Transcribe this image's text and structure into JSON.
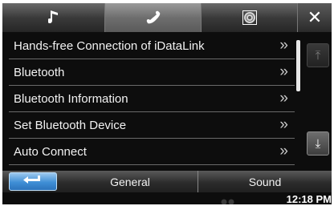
{
  "tabs": [
    {
      "name": "music",
      "icon": "music-note-icon",
      "active": false
    },
    {
      "name": "phone",
      "icon": "phone-icon",
      "active": true
    },
    {
      "name": "media",
      "icon": "disc-icon",
      "active": false
    }
  ],
  "close_icon": "close-icon",
  "close_glyph": "✕",
  "menu": {
    "items": [
      {
        "label": "Hands-free Connection of iDataLink",
        "chevron": "»"
      },
      {
        "label": "Bluetooth",
        "chevron": "»"
      },
      {
        "label": "Bluetooth Information",
        "chevron": "»"
      },
      {
        "label": "Set Bluetooth Device",
        "chevron": "»"
      },
      {
        "label": "Auto Connect",
        "chevron": "»"
      }
    ]
  },
  "scroll": {
    "up_glyph": "⤒",
    "down_glyph": "⤓"
  },
  "bottom": {
    "back_icon": "back-arrow-icon",
    "tabs": [
      {
        "label": "General"
      },
      {
        "label": "Sound"
      }
    ]
  },
  "status": {
    "time": "12:18 PM"
  },
  "colors": {
    "accent": "#3f8fd6",
    "background": "#0d0d0d"
  }
}
